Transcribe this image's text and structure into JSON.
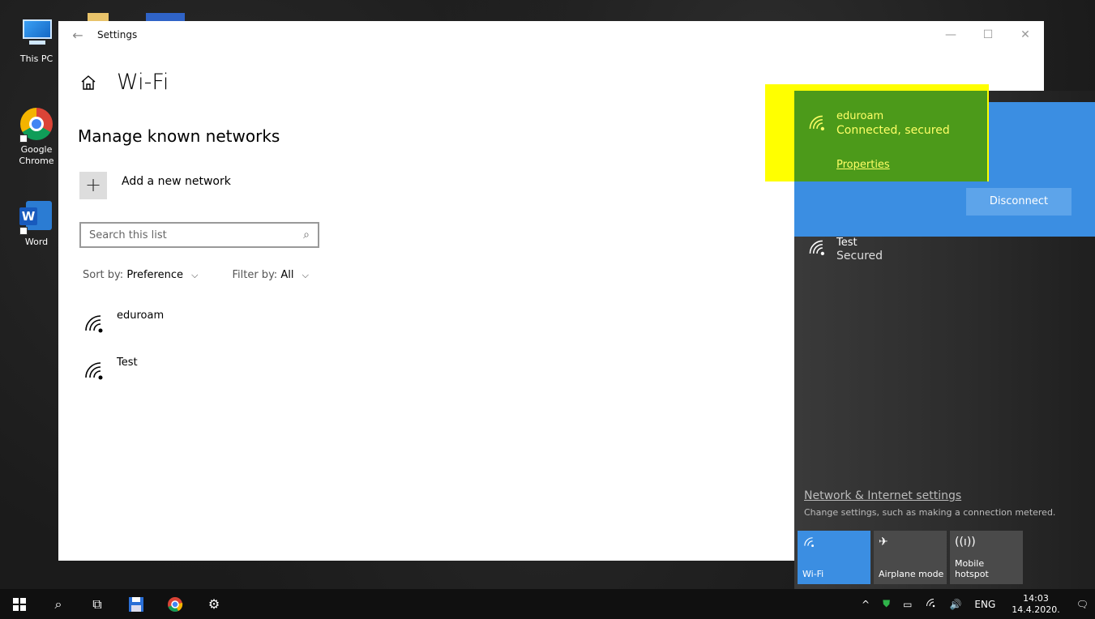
{
  "desktop": {
    "icons": [
      {
        "label": "This PC"
      },
      {
        "label": "Google Chrome"
      },
      {
        "label": "Word"
      }
    ]
  },
  "window": {
    "title": "Settings",
    "back": "←",
    "minimize": "—",
    "maximize": "☐",
    "close": "✕"
  },
  "page": {
    "title": "Wi-Fi",
    "section_title": "Manage known networks",
    "add_label": "Add a new network",
    "add_symbol": "+",
    "search_placeholder": "Search this list",
    "sort_prefix": "Sort by:",
    "sort_value": "Preference",
    "filter_prefix": "Filter by:",
    "filter_value": "All",
    "networks": [
      {
        "name": "eduroam"
      },
      {
        "name": "Test"
      }
    ]
  },
  "flyout": {
    "connected": {
      "name": "eduroam",
      "status": "Connected, secured",
      "properties_label": "Properties",
      "disconnect_label": "Disconnect"
    },
    "other": {
      "name": "Test",
      "status": "Secured"
    },
    "settings_link": "Network & Internet settings",
    "settings_sub": "Change settings, such as making a connection metered.",
    "tiles": [
      {
        "label": "Wi-Fi"
      },
      {
        "label": "Airplane mode"
      },
      {
        "label_line1": "Mobile",
        "label_line2": "hotspot"
      }
    ]
  },
  "taskbar": {
    "language": "ENG",
    "time": "14:03",
    "date": "14.4.2020."
  },
  "colors": {
    "highlight": "#ffff00",
    "highlight_inner": "#4c9a1a",
    "accent": "#3b8ee2"
  }
}
